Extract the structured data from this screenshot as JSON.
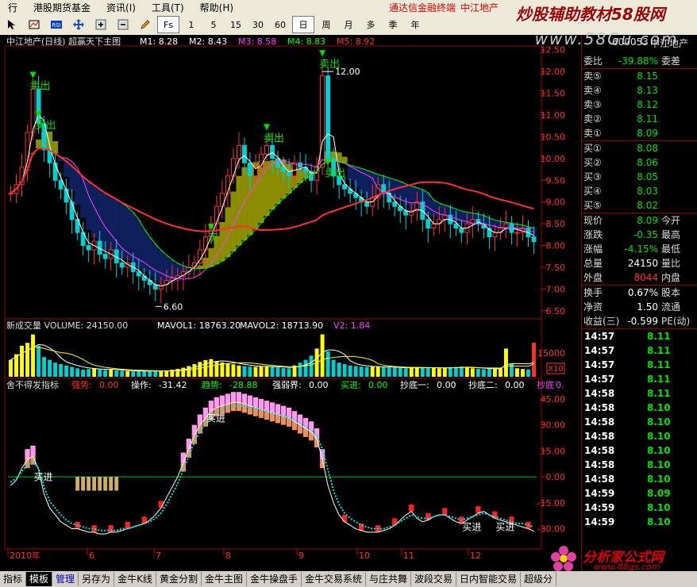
{
  "menubar": {
    "items": [
      "行",
      "港股期货基金",
      "资讯(I)",
      "工具(T)",
      "帮助(H)"
    ],
    "promo": "通达信金融终端",
    "stock_name": "中江地产"
  },
  "toolbar": {
    "periods": [
      "1",
      "5",
      "15",
      "30",
      "60",
      "日",
      "周",
      "月",
      "多",
      "季",
      "年"
    ],
    "selected_period": "日",
    "fs_label": "Fs"
  },
  "watermark": {
    "title": "炒股辅助教材58股网",
    "url": "www.58Gu.com"
  },
  "main_chart": {
    "title": "中江地产(日线) 超赢天下主图",
    "ma": [
      {
        "label": "M1: 8.28",
        "color": "#ffffff"
      },
      {
        "label": "M2: 8.43",
        "color": "#ffffff"
      },
      {
        "label": "M3: 8.58",
        "color": "#ff40ff"
      },
      {
        "label": "M4: 8.83",
        "color": "#00ff00"
      },
      {
        "label": "M5: 8.92",
        "color": "#ff3030"
      }
    ],
    "y_ticks": [
      "12.50",
      "12.00",
      "11.50",
      "11.00",
      "10.50",
      "10.00",
      "9.50",
      "9.00",
      "8.50",
      "8.00",
      "7.50",
      "7.00",
      "6.50"
    ],
    "y_range": [
      6.35,
      12.55
    ],
    "high_label": "12.00",
    "low_label": "6.60",
    "signals": [
      {
        "text": "卖出",
        "day": 4,
        "price": 11.7
      },
      {
        "text": "卖出",
        "day": 5,
        "price": 10.8
      },
      {
        "text": "卖出",
        "day": 46,
        "price": 10.5
      },
      {
        "text": "卖出",
        "day": 56,
        "price": 12.2
      },
      {
        "text": "卖出",
        "day": 57,
        "price": 9.7
      },
      {
        "text": "买",
        "day": 36,
        "price": 8.2
      }
    ]
  },
  "volume_chart": {
    "title": "新成交量 VOLUME: 24150.00",
    "mavol1": "MAVOL1: 18763.20",
    "mavol2": "MAVOL2: 18713.90",
    "v2": "V2: 1.84",
    "y_tick": "15000",
    "unit": "X10"
  },
  "indicator_chart": {
    "name": "舍不得发指标",
    "fields": [
      {
        "label": "强势:",
        "value": "0.00",
        "color": "#ff3030"
      },
      {
        "label": "操作:",
        "value": "-31.42",
        "color": "#ffffff"
      },
      {
        "label": "趋势:",
        "value": "-28.88",
        "color": "#00ff00"
      },
      {
        "label": "强弱界:",
        "value": "0.00",
        "color": "#ffffff"
      },
      {
        "label": "买进:",
        "value": "0.00",
        "color": "#00ff00"
      },
      {
        "label": "抄底一:",
        "value": "0.00",
        "color": "#ffffff"
      },
      {
        "label": "抄底二:",
        "value": "0.00",
        "color": "#ffffff"
      },
      {
        "label": "抄底",
        "value": "0.",
        "color": "#ff40ff"
      }
    ],
    "y_ticks": [
      "45.00",
      "30.00",
      "15.00",
      "0.00",
      "-15.00",
      "-30.00"
    ],
    "buy_labels": [
      "买进",
      "买进",
      "买进",
      "买进"
    ]
  },
  "x_axis": {
    "labels": [
      "2010年",
      "6",
      "7",
      "8",
      "9",
      "10",
      "11",
      "12"
    ]
  },
  "chart_data": [
    {
      "type": "candlestick",
      "title": "中江地产(日线) 超赢天下主图",
      "ylim": [
        6.35,
        12.55
      ],
      "close": [
        9.2,
        9.4,
        9.8,
        10.6,
        11.6,
        10.8,
        10.2,
        9.9,
        9.5,
        9.3,
        9.0,
        8.6,
        8.3,
        8.0,
        7.9,
        8.1,
        7.8,
        7.7,
        7.9,
        7.6,
        7.5,
        7.6,
        7.4,
        7.3,
        7.2,
        7.1,
        7.0,
        7.1,
        7.2,
        7.25,
        7.3,
        7.4,
        7.5,
        7.6,
        7.9,
        8.2,
        8.5,
        8.9,
        9.2,
        9.6,
        10.0,
        10.3,
        9.9,
        9.6,
        9.8,
        10.1,
        10.3,
        10.0,
        9.8,
        9.7,
        9.6,
        9.9,
        9.8,
        9.7,
        9.5,
        9.8,
        11.9,
        10.0,
        9.6,
        9.4,
        9.3,
        9.2,
        9.1,
        9.0,
        8.9,
        9.1,
        9.4,
        9.2,
        9.0,
        8.9,
        8.8,
        8.7,
        8.8,
        9.0,
        8.6,
        8.4,
        8.5,
        8.6,
        8.7,
        8.5,
        8.4,
        8.3,
        8.5,
        8.6,
        8.5,
        8.4,
        8.2,
        8.3,
        8.4,
        8.5,
        8.3,
        8.3,
        8.4,
        8.2,
        8.09
      ]
    },
    {
      "type": "bar",
      "title": "新成交量 VOLUME",
      "unit": "X10",
      "values": [
        12000,
        16000,
        22000,
        24000,
        30000,
        22000,
        14000,
        12000,
        10000,
        9000,
        8000,
        7000,
        6000,
        5000,
        5500,
        6000,
        5200,
        4800,
        5000,
        4500,
        4200,
        4000,
        3800,
        4000,
        4200,
        4500,
        4000,
        3800,
        4200,
        5000,
        5600,
        6400,
        7600,
        9000,
        10500,
        11800,
        12500,
        11000,
        10200,
        9600,
        8800,
        8000,
        7600,
        7200,
        7000,
        7400,
        7600,
        7000,
        6600,
        6200,
        6000,
        8000,
        10000,
        12000,
        15000,
        20000,
        30000,
        18000,
        12000,
        10000,
        9000,
        8000,
        7600,
        7200,
        7000,
        7200,
        7000,
        6800,
        6600,
        6400,
        6200,
        6000,
        6400,
        6800,
        6600,
        6400,
        6200,
        6000,
        6400,
        6800,
        7000,
        7200,
        6600,
        6000,
        5600,
        5400,
        5600,
        5800,
        6000,
        20000,
        9000,
        6000,
        5500,
        5200,
        24150
      ]
    },
    {
      "type": "line",
      "title": "舍不得发指标",
      "ylim": [
        -38,
        50
      ],
      "series": [
        {
          "name": "操作",
          "values": [
            -5,
            -2,
            5,
            10,
            12,
            4,
            -10,
            -18,
            -22,
            -26,
            -28,
            -30,
            -30,
            -31,
            -32,
            -32,
            -33,
            -33,
            -32,
            -32,
            -31,
            -30,
            -29,
            -28,
            -27,
            -25,
            -22,
            -18,
            -12,
            -6,
            0,
            8,
            16,
            24,
            30,
            34,
            38,
            40,
            41,
            42,
            43,
            43,
            42,
            41,
            40,
            39,
            38,
            37,
            36,
            35,
            34,
            32,
            30,
            28,
            26,
            22,
            10,
            -5,
            -15,
            -22,
            -26,
            -28,
            -30,
            -31,
            -32,
            -32,
            -32,
            -31,
            -30,
            -28,
            -25,
            -22,
            -20,
            -24,
            -26,
            -25,
            -23,
            -22,
            -22,
            -24,
            -26,
            -27,
            -25,
            -23,
            -21,
            -20,
            -22,
            -24,
            -25,
            -26,
            -27,
            -28,
            -29,
            -30,
            -31.42
          ]
        },
        {
          "name": "趋势",
          "values": [
            -3,
            -1,
            3,
            7,
            9,
            5,
            -6,
            -14,
            -18,
            -22,
            -25,
            -27,
            -28,
            -29,
            -30,
            -30,
            -31,
            -31,
            -31,
            -31,
            -30,
            -30,
            -29,
            -28,
            -27,
            -26,
            -24,
            -21,
            -16,
            -10,
            -4,
            4,
            12,
            20,
            26,
            31,
            35,
            37,
            39,
            40,
            41,
            41,
            41,
            40,
            40,
            39,
            38,
            37,
            36,
            35,
            34,
            33,
            31,
            29,
            27,
            24,
            16,
            4,
            -8,
            -16,
            -21,
            -24,
            -26,
            -28,
            -29,
            -30,
            -30,
            -30,
            -29,
            -28,
            -26,
            -24,
            -22,
            -23,
            -24,
            -24,
            -23,
            -22,
            -22,
            -23,
            -24,
            -25,
            -24,
            -23,
            -22,
            -21,
            -22,
            -23,
            -24,
            -25,
            -26,
            -27,
            -27,
            -28,
            -28.88
          ]
        }
      ]
    }
  ],
  "right_panel": {
    "code": "600053",
    "name": "中江地产",
    "weibi": {
      "label": "委比",
      "value": "-39.88%",
      "right": "委差"
    },
    "asks": [
      {
        "label": "卖⑤",
        "price": "8.15"
      },
      {
        "label": "卖④",
        "price": "8.13"
      },
      {
        "label": "卖③",
        "price": "8.12"
      },
      {
        "label": "卖②",
        "price": "8.11"
      },
      {
        "label": "卖①",
        "price": "8.09"
      }
    ],
    "bids": [
      {
        "label": "买①",
        "price": "8.08"
      },
      {
        "label": "买②",
        "price": "8.06"
      },
      {
        "label": "买③",
        "price": "8.05"
      },
      {
        "label": "买④",
        "price": "8.03"
      },
      {
        "label": "买⑤",
        "price": "8.02"
      }
    ],
    "stats": [
      {
        "label": "现价",
        "value": "8.09",
        "right": "今开",
        "color": "g"
      },
      {
        "label": "涨跌",
        "value": "-0.35",
        "right": "最高",
        "color": "g"
      },
      {
        "label": "涨幅",
        "value": "-4.15%",
        "right": "最低",
        "color": "g"
      },
      {
        "label": "总量",
        "value": "24150",
        "right": "量比",
        "color": "w"
      },
      {
        "label": "外盘",
        "value": "8044",
        "right": "内盘",
        "color": "rd"
      }
    ],
    "stats2": [
      {
        "label": "换手",
        "value": "0.67%",
        "right": "股本",
        "color": "w"
      },
      {
        "label": "净资",
        "value": "1.50",
        "right": "流通",
        "color": "w"
      },
      {
        "label": "收益(三)",
        "value": "-0.599",
        "right": "PE(动)",
        "color": "w"
      }
    ],
    "ticks": [
      {
        "time": "14:57",
        "price": "8.11"
      },
      {
        "time": "14:57",
        "price": "8.11"
      },
      {
        "time": "14:57",
        "price": "8.11"
      },
      {
        "time": "14:57",
        "price": "8.11"
      },
      {
        "time": "14:58",
        "price": "8.11"
      },
      {
        "time": "14:58",
        "price": "8.10"
      },
      {
        "time": "14:58",
        "price": "8.10"
      },
      {
        "time": "14:58",
        "price": "8.10"
      },
      {
        "time": "14:58",
        "price": "8.10"
      },
      {
        "time": "14:58",
        "price": "8.10"
      },
      {
        "time": "14:58",
        "price": "8.10"
      },
      {
        "time": "14:59",
        "price": "8.09"
      },
      {
        "time": "14:59",
        "price": "8.10"
      },
      {
        "time": "14:59",
        "price": "8.10"
      }
    ]
  },
  "tabs": [
    "指标",
    "模板",
    "管理",
    "另存为",
    "金牛K线",
    "黄金分割",
    "金牛主图",
    "金牛操盘手",
    "金牛交易系统",
    "与庄共舞",
    "波段交易",
    "日内智能交易",
    "超级分"
  ],
  "logo88": {
    "title": "分析家公式网",
    "url": "www.88gs.com"
  }
}
